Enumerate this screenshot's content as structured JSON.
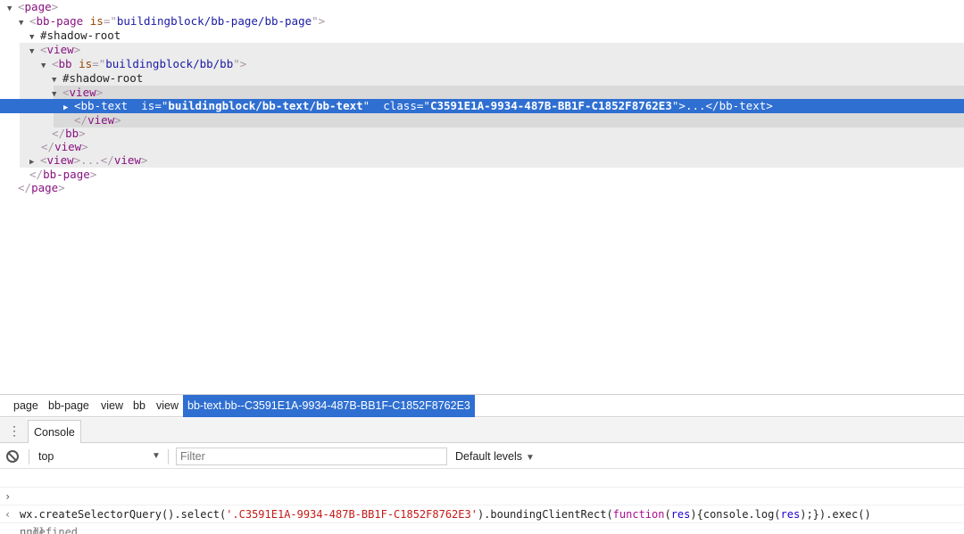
{
  "tree": {
    "l1_tag": "page",
    "l2_tag": "bb-page",
    "l2_attr": "is",
    "l2_val": "buildingblock/bb-page/bb-page",
    "shadow1": "#shadow-root",
    "l4_tag": "view",
    "l5_tag": "bb",
    "l5_attr": "is",
    "l5_val": "buildingblock/bb/bb",
    "shadow2": "#shadow-root",
    "l7_tag": "view",
    "sel_tag": "bb-text",
    "sel_attr1": "is",
    "sel_val1": "buildingblock/bb-text/bb-text",
    "sel_attr2": "class",
    "sel_val2": "C3591E1A-9934-487B-BB1F-C1852F8762E3",
    "sel_ellipsis": "...",
    "sel_close": "bb-text",
    "close_view1": "view",
    "close_bb": "bb",
    "close_view2": "view",
    "collapsed_view": "view",
    "collapsed_ellipsis": "...",
    "collapsed_close": "view",
    "close_bbpage": "bb-page",
    "close_page": "page"
  },
  "breadcrumb": [
    "page",
    "bb-page",
    "view",
    "bb",
    "view",
    "bb-text.bb--C3591E1A-9934-487B-BB1F-C1852F8762E3"
  ],
  "console_tab": "Console",
  "toolbar": {
    "context": "top",
    "filter_placeholder": "Filter",
    "levels": "Default levels"
  },
  "console": {
    "cmd_pre": "wx.createSelectorQuery().select(",
    "cmd_str": "'.C3591E1A-9934-487B-BB1F-C1852F8762E3'",
    "cmd_mid": ").boundingClientRect(",
    "cmd_kw": "function",
    "cmd_paren": "(",
    "cmd_res1": "res",
    "cmd_body1": "){console.log(",
    "cmd_res2": "res",
    "cmd_tail": ");}).exec()",
    "result1": "undefined",
    "result2": "null"
  },
  "colors": {
    "selection": "#2f6fd1",
    "tag": "#881280",
    "attribute": "#994500",
    "value": "#1a1aa6"
  }
}
